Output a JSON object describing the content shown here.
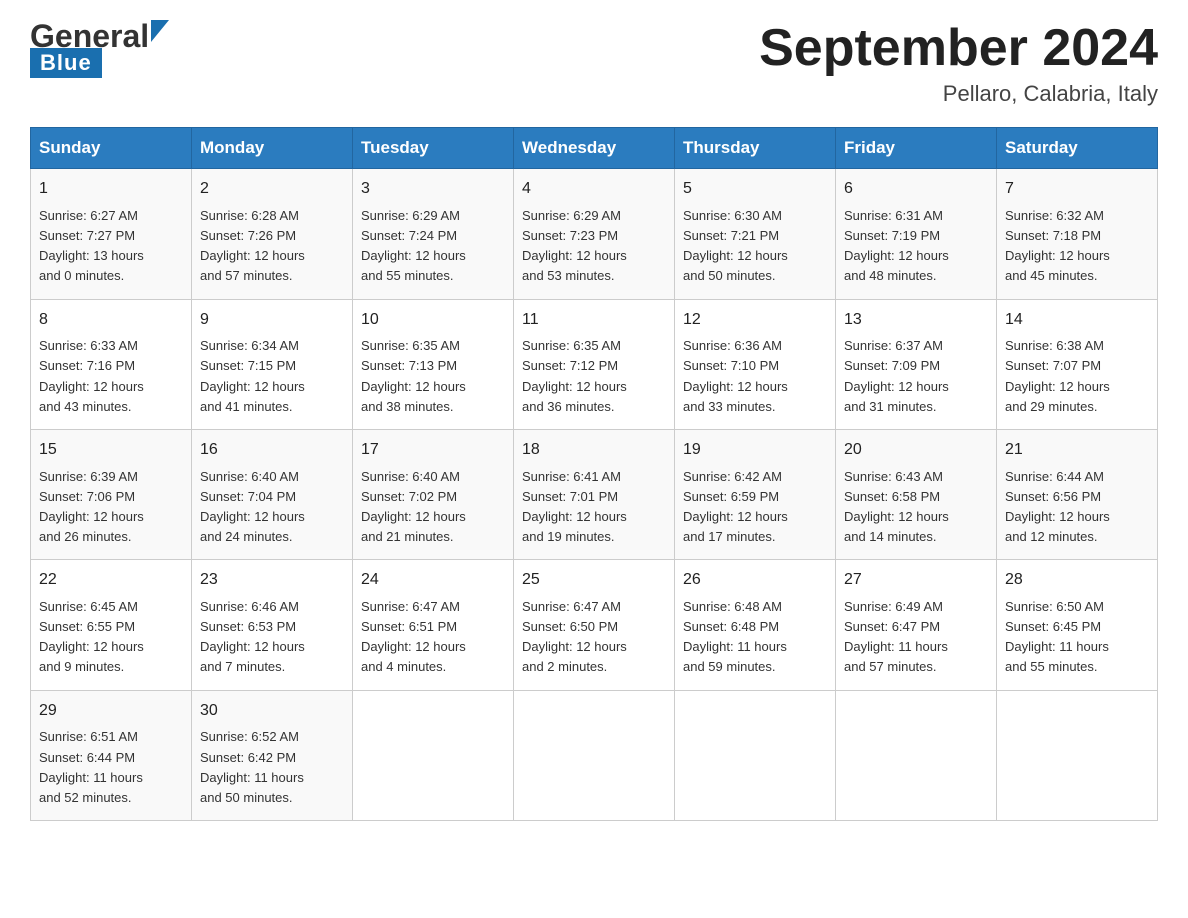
{
  "header": {
    "logo_general": "General",
    "logo_blue": "Blue",
    "main_title": "September 2024",
    "subtitle": "Pellaro, Calabria, Italy"
  },
  "days_of_week": [
    "Sunday",
    "Monday",
    "Tuesday",
    "Wednesday",
    "Thursday",
    "Friday",
    "Saturday"
  ],
  "weeks": [
    [
      {
        "day": "1",
        "sunrise": "6:27 AM",
        "sunset": "7:27 PM",
        "daylight": "13 hours and 0 minutes."
      },
      {
        "day": "2",
        "sunrise": "6:28 AM",
        "sunset": "7:26 PM",
        "daylight": "12 hours and 57 minutes."
      },
      {
        "day": "3",
        "sunrise": "6:29 AM",
        "sunset": "7:24 PM",
        "daylight": "12 hours and 55 minutes."
      },
      {
        "day": "4",
        "sunrise": "6:29 AM",
        "sunset": "7:23 PM",
        "daylight": "12 hours and 53 minutes."
      },
      {
        "day": "5",
        "sunrise": "6:30 AM",
        "sunset": "7:21 PM",
        "daylight": "12 hours and 50 minutes."
      },
      {
        "day": "6",
        "sunrise": "6:31 AM",
        "sunset": "7:19 PM",
        "daylight": "12 hours and 48 minutes."
      },
      {
        "day": "7",
        "sunrise": "6:32 AM",
        "sunset": "7:18 PM",
        "daylight": "12 hours and 45 minutes."
      }
    ],
    [
      {
        "day": "8",
        "sunrise": "6:33 AM",
        "sunset": "7:16 PM",
        "daylight": "12 hours and 43 minutes."
      },
      {
        "day": "9",
        "sunrise": "6:34 AM",
        "sunset": "7:15 PM",
        "daylight": "12 hours and 41 minutes."
      },
      {
        "day": "10",
        "sunrise": "6:35 AM",
        "sunset": "7:13 PM",
        "daylight": "12 hours and 38 minutes."
      },
      {
        "day": "11",
        "sunrise": "6:35 AM",
        "sunset": "7:12 PM",
        "daylight": "12 hours and 36 minutes."
      },
      {
        "day": "12",
        "sunrise": "6:36 AM",
        "sunset": "7:10 PM",
        "daylight": "12 hours and 33 minutes."
      },
      {
        "day": "13",
        "sunrise": "6:37 AM",
        "sunset": "7:09 PM",
        "daylight": "12 hours and 31 minutes."
      },
      {
        "day": "14",
        "sunrise": "6:38 AM",
        "sunset": "7:07 PM",
        "daylight": "12 hours and 29 minutes."
      }
    ],
    [
      {
        "day": "15",
        "sunrise": "6:39 AM",
        "sunset": "7:06 PM",
        "daylight": "12 hours and 26 minutes."
      },
      {
        "day": "16",
        "sunrise": "6:40 AM",
        "sunset": "7:04 PM",
        "daylight": "12 hours and 24 minutes."
      },
      {
        "day": "17",
        "sunrise": "6:40 AM",
        "sunset": "7:02 PM",
        "daylight": "12 hours and 21 minutes."
      },
      {
        "day": "18",
        "sunrise": "6:41 AM",
        "sunset": "7:01 PM",
        "daylight": "12 hours and 19 minutes."
      },
      {
        "day": "19",
        "sunrise": "6:42 AM",
        "sunset": "6:59 PM",
        "daylight": "12 hours and 17 minutes."
      },
      {
        "day": "20",
        "sunrise": "6:43 AM",
        "sunset": "6:58 PM",
        "daylight": "12 hours and 14 minutes."
      },
      {
        "day": "21",
        "sunrise": "6:44 AM",
        "sunset": "6:56 PM",
        "daylight": "12 hours and 12 minutes."
      }
    ],
    [
      {
        "day": "22",
        "sunrise": "6:45 AM",
        "sunset": "6:55 PM",
        "daylight": "12 hours and 9 minutes."
      },
      {
        "day": "23",
        "sunrise": "6:46 AM",
        "sunset": "6:53 PM",
        "daylight": "12 hours and 7 minutes."
      },
      {
        "day": "24",
        "sunrise": "6:47 AM",
        "sunset": "6:51 PM",
        "daylight": "12 hours and 4 minutes."
      },
      {
        "day": "25",
        "sunrise": "6:47 AM",
        "sunset": "6:50 PM",
        "daylight": "12 hours and 2 minutes."
      },
      {
        "day": "26",
        "sunrise": "6:48 AM",
        "sunset": "6:48 PM",
        "daylight": "11 hours and 59 minutes."
      },
      {
        "day": "27",
        "sunrise": "6:49 AM",
        "sunset": "6:47 PM",
        "daylight": "11 hours and 57 minutes."
      },
      {
        "day": "28",
        "sunrise": "6:50 AM",
        "sunset": "6:45 PM",
        "daylight": "11 hours and 55 minutes."
      }
    ],
    [
      {
        "day": "29",
        "sunrise": "6:51 AM",
        "sunset": "6:44 PM",
        "daylight": "11 hours and 52 minutes."
      },
      {
        "day": "30",
        "sunrise": "6:52 AM",
        "sunset": "6:42 PM",
        "daylight": "11 hours and 50 minutes."
      },
      null,
      null,
      null,
      null,
      null
    ]
  ]
}
